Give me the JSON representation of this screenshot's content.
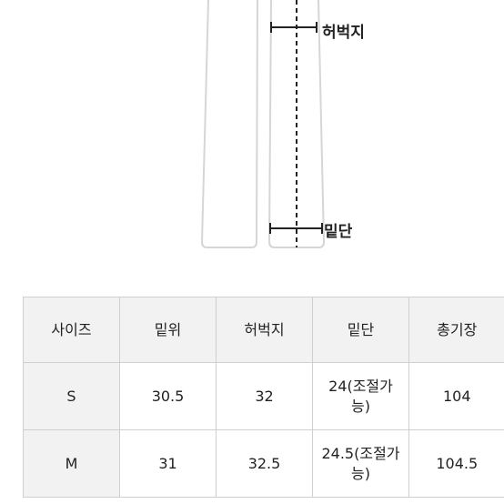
{
  "diagram": {
    "labels": {
      "waist": "허벅지",
      "hem": "밑단"
    }
  },
  "table": {
    "headers": [
      "사이즈",
      "밑위",
      "허벅지",
      "밑단",
      "총기장"
    ],
    "rows": [
      [
        "S",
        "30.5",
        "32",
        "24(조절가능)",
        "104"
      ],
      [
        "M",
        "31",
        "32.5",
        "24.5(조절가능)",
        "104.5"
      ]
    ],
    "hem_lines": [
      [
        "24(조절가",
        "능)"
      ],
      [
        "24.5(조절가",
        "능)"
      ]
    ]
  }
}
